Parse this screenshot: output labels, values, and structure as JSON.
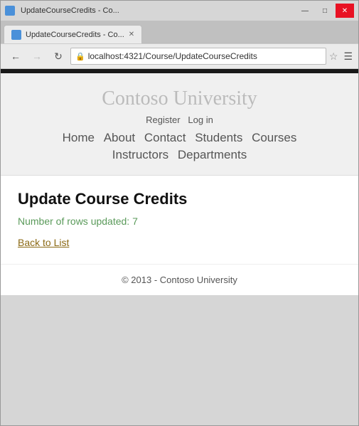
{
  "browser": {
    "tab_title": "UpdateCourseCredits - Co...",
    "window_controls": {
      "minimize": "—",
      "maximize": "□",
      "close": "✕"
    },
    "address": "localhost:4321/Course/UpdateCourseCredits",
    "address_icon": "🔒"
  },
  "site": {
    "title": "Contoso University",
    "auth": {
      "register": "Register",
      "login": "Log in"
    },
    "nav": {
      "home": "Home",
      "about": "About",
      "contact": "Contact",
      "students": "Students",
      "courses": "Courses",
      "instructors": "Instructors",
      "departments": "Departments"
    },
    "page": {
      "title": "Update Course Credits",
      "status": "Number of rows updated: 7",
      "back_link": "Back to List"
    },
    "footer": "© 2013 - Contoso University"
  }
}
